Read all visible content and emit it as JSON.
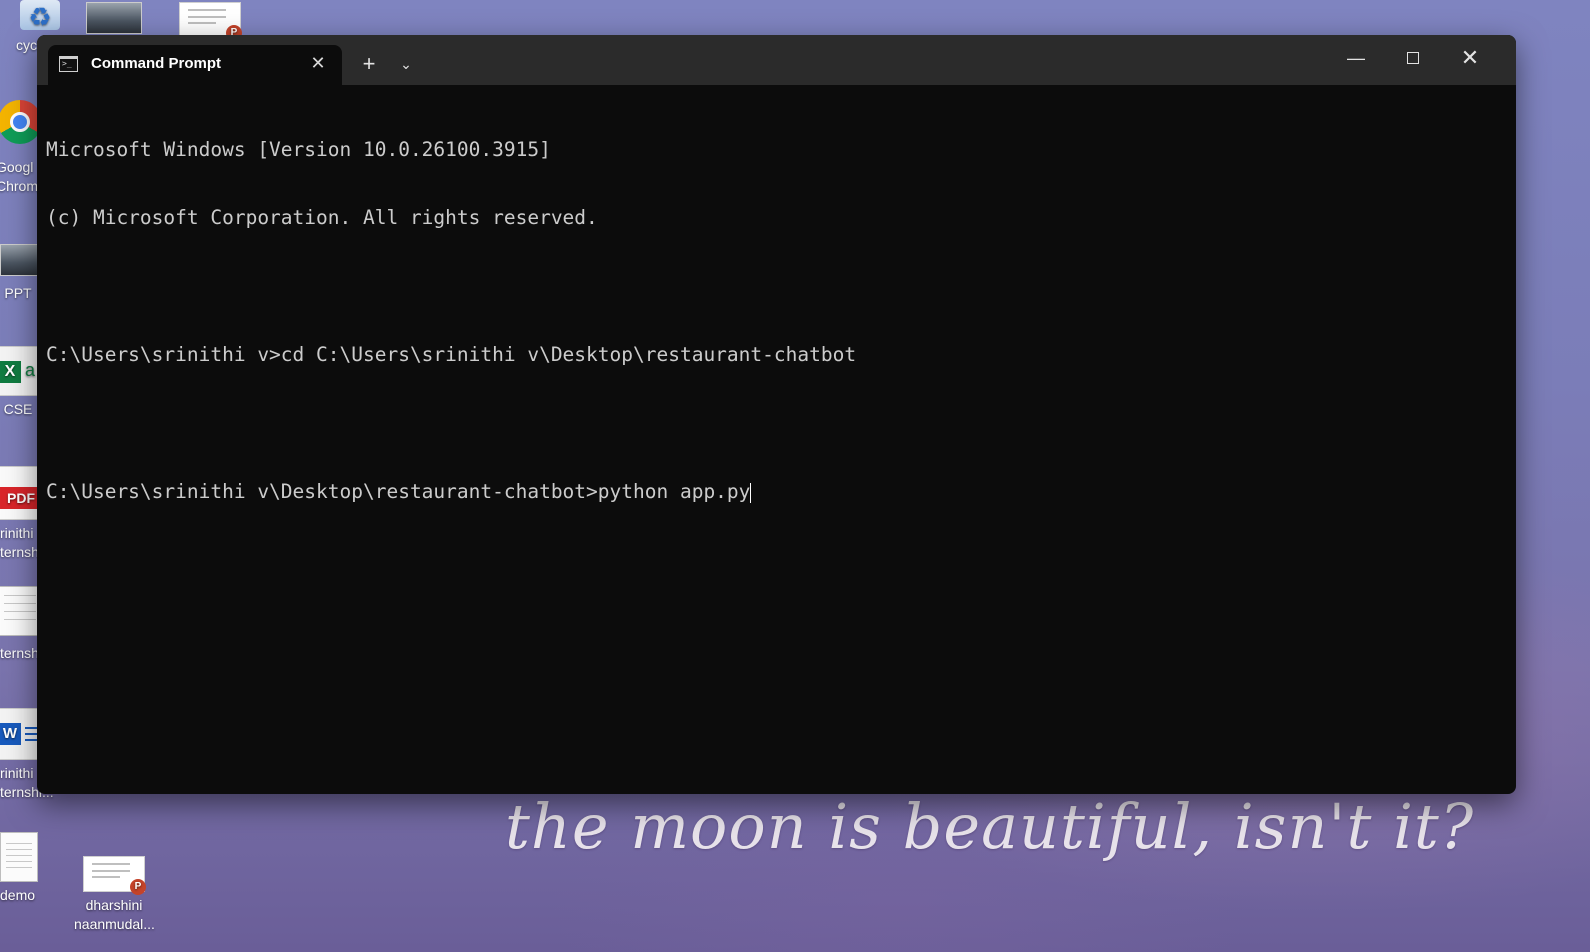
{
  "wallpaper": {
    "quote": "the moon is beautiful, isn't it?"
  },
  "desktop_icons": [
    {
      "label": "cycle",
      "icon": "recycle-bin-icon"
    },
    {
      "label": "",
      "icon": "photo-thumbnail"
    },
    {
      "label": "",
      "icon": "powerpoint-thumbnail"
    },
    {
      "label": "Googl\nChrom",
      "icon": "chrome-icon"
    },
    {
      "label": "PPT",
      "icon": "photo-thumbnail"
    },
    {
      "label": "CSE",
      "icon": "excel-icon"
    },
    {
      "label": "rinithi\nternsh",
      "icon": "pdf-icon"
    },
    {
      "label": "ternsh",
      "icon": "document-thumbnail"
    },
    {
      "label": "rinithi\nternshi...",
      "icon": "word-icon"
    },
    {
      "label": "demo",
      "icon": "text-file-icon"
    },
    {
      "label": "dharshini\nnaanmudal...",
      "icon": "powerpoint-thumbnail"
    }
  ],
  "window": {
    "tab_title": "Command Prompt",
    "tab_icon": "command-prompt-icon",
    "controls": {
      "new_tab": "+",
      "dropdown": "⌄",
      "minimize": "—",
      "close": "✕",
      "tab_close": "✕"
    }
  },
  "console": {
    "lines": [
      "Microsoft Windows [Version 10.0.26100.3915]",
      "(c) Microsoft Corporation. All rights reserved.",
      "",
      "C:\\Users\\srinithi v>cd C:\\Users\\srinithi v\\Desktop\\restaurant-chatbot",
      "",
      "C:\\Users\\srinithi v\\Desktop\\restaurant-chatbot>python app.py"
    ]
  },
  "colors": {
    "console_bg": "#0c0c0c",
    "titlebar_bg": "#2b2b2b",
    "console_text": "#cccccc"
  }
}
